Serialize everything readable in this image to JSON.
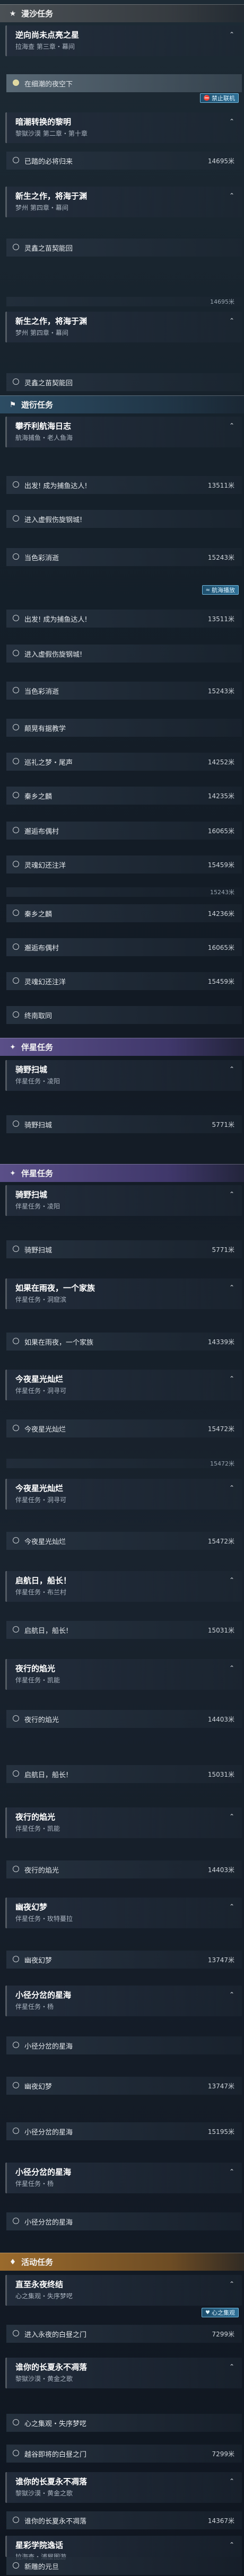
{
  "sections": {
    "quest": "漫沙任务",
    "travel": "遊衍任务",
    "companion": "伴星任务",
    "activity": "活动任务"
  },
  "labels": {
    "forbidden": "禁止联机",
    "sailing": "航海播放",
    "heart_set": "心之集观"
  },
  "cards": [
    {
      "id": "c1",
      "title": "逆向尚未点亮之星",
      "subtitle": "拉海查 第三章・幕间"
    },
    {
      "id": "c2",
      "title": "暗潮转换的黎明",
      "subtitle": "黎獄沙漠 第二章・第十章"
    },
    {
      "id": "c3",
      "title": "新生之作，将海于渊",
      "subtitle": "梦州 第四章・幕间"
    },
    {
      "id": "c4",
      "title": "新生之作，将海于渊",
      "subtitle": "梦州 第四章・幕间"
    },
    {
      "id": "c5",
      "title": "攀乔利航海日志",
      "subtitle": "航海捕鱼・老人鱼海"
    },
    {
      "id": "c6",
      "title": "骑野扫城",
      "subtitle": "伴星任务・凌阳"
    },
    {
      "id": "c7",
      "title": "骑野扫城",
      "subtitle": "伴星任务・凌阳"
    },
    {
      "id": "c8",
      "title": "如果在雨夜，一个家族",
      "subtitle": "伴星任务・洞窟滨"
    },
    {
      "id": "c9",
      "title": "今夜星光灿烂",
      "subtitle": "伴星任务・洞寻可"
    },
    {
      "id": "c10",
      "title": "今夜星光灿烂",
      "subtitle": "伴星任务・洞寻可"
    },
    {
      "id": "c11",
      "title": "启航日，船长！",
      "subtitle": "伴星任务・布兰村"
    },
    {
      "id": "c12",
      "title": "夜行的焰光",
      "subtitle": "伴星任务・凯能"
    },
    {
      "id": "c13",
      "title": "夜行的焰光",
      "subtitle": "伴星任务・凯能"
    },
    {
      "id": "c14",
      "title": "幽夜幻梦",
      "subtitle": "伴星任务・玫特蔓拉"
    },
    {
      "id": "c15",
      "title": "小径分岔的星海",
      "subtitle": "伴星任务・杨"
    },
    {
      "id": "c16",
      "title": "小径分岔的星海",
      "subtitle": "伴星任务・杨"
    },
    {
      "id": "c17",
      "title": "直至永夜终结",
      "subtitle": "心之集观・失序梦呓"
    },
    {
      "id": "c18",
      "title": "谁你的长夏永不凋落",
      "subtitle": "黎獄沙漠・黄金之歌"
    },
    {
      "id": "c19",
      "title": "谁你的长夏永不凋落",
      "subtitle": "黎獄沙漠・黄金之歌"
    },
    {
      "id": "c20",
      "title": "星彩学院逸话",
      "subtitle": "拉海查・浦屋图游"
    }
  ],
  "rows": [
    {
      "id": "r1",
      "text": "在细潮的夜空下",
      "dist": ""
    },
    {
      "id": "r2",
      "text": "已踏的必将归来",
      "dist": "14695米"
    },
    {
      "id": "r3",
      "text": "灵鑫之苗契能回",
      "dist": ""
    },
    {
      "id": "r4",
      "text": "灵鑫之苗契能回",
      "dist": ""
    },
    {
      "id": "r5",
      "text": "出发! 成为捕鱼达人!",
      "dist": "13511米"
    },
    {
      "id": "r6",
      "text": "进入虚假伤旋钢城!",
      "dist": ""
    },
    {
      "id": "r7",
      "text": "当色彩消逝",
      "dist": "15243米"
    },
    {
      "id": "r8",
      "text": "出发! 成为捕鱼达人!",
      "dist": "13511米"
    },
    {
      "id": "r9",
      "text": "进入虚假伤旋钢城!",
      "dist": ""
    },
    {
      "id": "r10",
      "text": "当色彩消逝",
      "dist": "15243米"
    },
    {
      "id": "r11",
      "text": "颠晃有据教学",
      "dist": ""
    },
    {
      "id": "r12",
      "text": "巡礼之梦・尾声",
      "dist": "14252米"
    },
    {
      "id": "r13",
      "text": "秦乡之麟",
      "dist": "14235米"
    },
    {
      "id": "r14",
      "text": "邂逅布偶村",
      "dist": "16065米"
    },
    {
      "id": "r15",
      "text": "灵魂幻还注洋",
      "dist": "15459米"
    },
    {
      "id": "r16",
      "text": "秦乡之麟",
      "dist": "14236米"
    },
    {
      "id": "r17",
      "text": "邂逅布偶村",
      "dist": "16065米"
    },
    {
      "id": "r18",
      "text": "灵魂幻还注洋",
      "dist": "15459米"
    },
    {
      "id": "r19",
      "text": "终南取同",
      "dist": ""
    },
    {
      "id": "r20",
      "text": "骑野扫城",
      "dist": "5771米"
    },
    {
      "id": "r21",
      "text": "骑野扫城",
      "dist": "5771米"
    },
    {
      "id": "r22",
      "text": "如果在雨夜，一个家族",
      "dist": "14339米"
    },
    {
      "id": "r23",
      "text": "今夜星光灿烂",
      "dist": "15472米"
    },
    {
      "id": "r24",
      "text": "今夜星光灿烂",
      "dist": "15472米"
    },
    {
      "id": "r25",
      "text": "启航日，船长!",
      "dist": "15031米"
    },
    {
      "id": "r26",
      "text": "夜行的焰光",
      "dist": "14403米"
    },
    {
      "id": "r27",
      "text": "启航日，船长!",
      "dist": "15031米"
    },
    {
      "id": "r28",
      "text": "夜行的焰光",
      "dist": "14403米"
    },
    {
      "id": "r29",
      "text": "幽夜幻梦",
      "dist": "13747米"
    },
    {
      "id": "r30",
      "text": "小径分岔的星海",
      "dist": ""
    },
    {
      "id": "r31",
      "text": "幽夜幻梦",
      "dist": "13747米"
    },
    {
      "id": "r32",
      "text": "小径分岔的星海",
      "dist": "15195米"
    },
    {
      "id": "r33",
      "text": "小径分岔的星海",
      "dist": ""
    },
    {
      "id": "r34",
      "text": "进入永夜的白昼之门",
      "dist": "7299米"
    },
    {
      "id": "r35",
      "text": "心之集观・失序梦呓",
      "dist": ""
    },
    {
      "id": "r36",
      "text": "越谷即将的白昼之门",
      "dist": "7299米"
    },
    {
      "id": "r37",
      "text": "谁你的长夏永不凋落",
      "dist": "14367米"
    },
    {
      "id": "r38",
      "text": "新雕的元旦",
      "dist": ""
    },
    {
      "id": "r39",
      "text": "幸福的咒语",
      "dist": ""
    },
    {
      "id": "r40",
      "text": "结语",
      "dist": ""
    }
  ],
  "thin_dist": [
    "14695米",
    "15243米",
    "15472米"
  ]
}
